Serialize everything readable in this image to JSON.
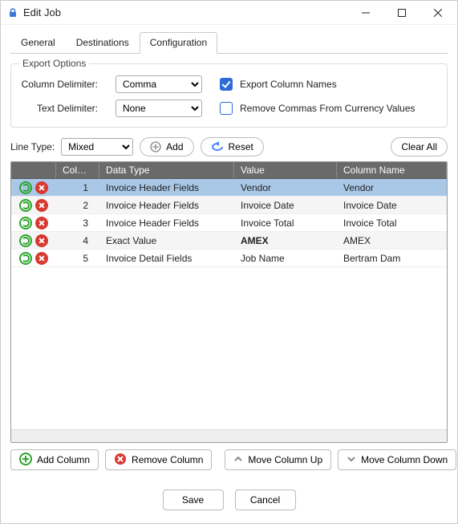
{
  "window": {
    "title": "Edit Job"
  },
  "tabs": [
    {
      "id": "general",
      "label": "General",
      "active": false
    },
    {
      "id": "destinations",
      "label": "Destinations",
      "active": false
    },
    {
      "id": "configuration",
      "label": "Configuration",
      "active": true
    }
  ],
  "export_options": {
    "title": "Export Options",
    "column_delimiter_label": "Column Delimiter:",
    "column_delimiter_value": "Comma",
    "text_delimiter_label": "Text Delimiter:",
    "text_delimiter_value": "None",
    "export_column_names_label": "Export Column Names",
    "export_column_names_checked": true,
    "remove_commas_label": "Remove Commas From Currency Values",
    "remove_commas_checked": false
  },
  "line_type": {
    "label": "Line Type:",
    "value": "Mixed",
    "add_label": "Add",
    "reset_label": "Reset",
    "clear_all_label": "Clear All"
  },
  "grid": {
    "headers": {
      "column": "Column",
      "data_type": "Data Type",
      "value": "Value",
      "column_name": "Column Name"
    },
    "rows": [
      {
        "col": "1",
        "type": "Invoice Header Fields",
        "value": "Vendor",
        "name": "Vendor",
        "selected": true,
        "bold": false
      },
      {
        "col": "2",
        "type": "Invoice Header Fields",
        "value": "Invoice Date",
        "name": "Invoice Date",
        "selected": false,
        "bold": false
      },
      {
        "col": "3",
        "type": "Invoice Header Fields",
        "value": "Invoice Total",
        "name": "Invoice Total",
        "selected": false,
        "bold": false
      },
      {
        "col": "4",
        "type": "Exact Value",
        "value": "AMEX",
        "name": "AMEX",
        "selected": false,
        "bold": true
      },
      {
        "col": "5",
        "type": "Invoice Detail Fields",
        "value": "Job Name",
        "name": "Bertram Dam",
        "selected": false,
        "bold": false
      }
    ]
  },
  "column_buttons": {
    "add": "Add Column",
    "remove": "Remove Column",
    "up": "Move Column Up",
    "down": "Move Column Down"
  },
  "footer": {
    "save": "Save",
    "cancel": "Cancel"
  },
  "colors": {
    "accent_green": "#2aa52a",
    "accent_red": "#d83a32",
    "accent_blue": "#2e6bd6",
    "reset_arrow": "#4a86ff"
  }
}
